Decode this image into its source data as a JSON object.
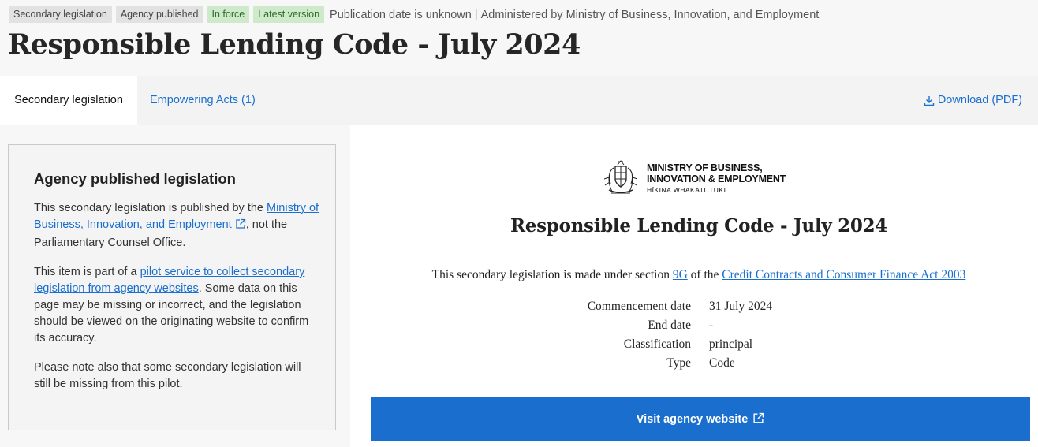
{
  "badges": [
    "Secondary legislation",
    "Agency published",
    "In force",
    "Latest version"
  ],
  "meta": {
    "publication": "Publication date is unknown",
    "separator": "|",
    "administered": "Administered by Ministry of Business, Innovation, and Employment"
  },
  "page_title": "Responsible Lending Code - July 2024",
  "tabs": {
    "active": "Secondary legislation",
    "acts": "Empowering Acts (1)",
    "download": "Download (PDF)"
  },
  "infobox": {
    "heading": "Agency published legislation",
    "p1_pre": "This secondary legislation is published by the ",
    "p1_link": "Ministry of Business, Innovation, and Employment",
    "p1_post": ", not the Parliamentary Counsel Office.",
    "p2_pre": "This item is part of a ",
    "p2_link": "pilot service to collect secondary legislation from agency websites",
    "p2_post": ". Some data on this page may be missing or incorrect, and the legislation should be viewed on the originating website to confirm its accuracy.",
    "p3": "Please note also that some secondary legislation will still be missing from this pilot."
  },
  "logo": {
    "line1": "MINISTRY OF BUSINESS,",
    "line2": "INNOVATION & EMPLOYMENT",
    "line3": "HĪKINA WHAKATUTUKI"
  },
  "document": {
    "title": "Responsible Lending Code - July 2024",
    "made_pre": "This secondary legislation is made under section ",
    "section": "9G",
    "made_mid": " of the ",
    "act": "Credit Contracts and Consumer Finance Act 2003",
    "rows": [
      {
        "key": "Commencement date",
        "value": "31 July 2024"
      },
      {
        "key": "End date",
        "value": "-"
      },
      {
        "key": "Classification",
        "value": "principal"
      },
      {
        "key": "Type",
        "value": "Code"
      }
    ]
  },
  "visit_button": "Visit agency website",
  "colors": {
    "link": "#1a6fce",
    "badge_green_bg": "#cfeacb",
    "badge_grey_bg": "#e2e2e2"
  }
}
